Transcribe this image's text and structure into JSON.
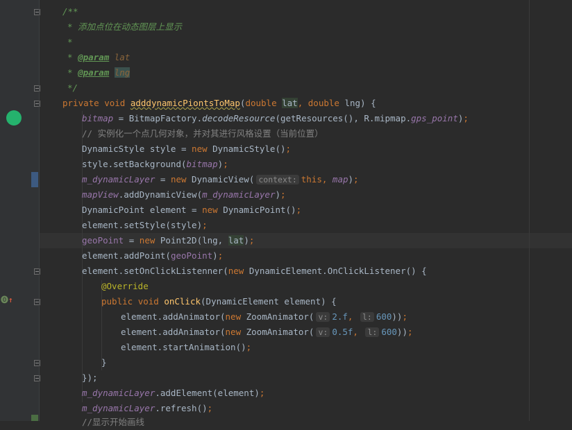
{
  "editor": {
    "doc_comment": {
      "open": "/**",
      "description": "* 添加点位在动态图层上显示",
      "blank": "*",
      "param_tag": "@param",
      "param1": "lat",
      "param2": "lng",
      "close": "*/"
    },
    "hints": {
      "context": "context:",
      "v": "v:",
      "l": "l:"
    },
    "strings": {
      "private": "private",
      "void": "void",
      "method_name": "adddynamicPiontsToMap",
      "double": "double",
      "lat": "lat",
      "lng": "lng",
      "bitmap": "bitmap",
      "bitmap_factory": " = BitmapFactory.",
      "decode": "decodeResource",
      "get_res": "(getResources(), R.mipmap.",
      "gps_point": "gps_point",
      "comment_line": "// 实例化一个点几何对象，并对其进行风格设置（当前位置）",
      "dynamic_style": "DynamicStyle style = ",
      "new": "new",
      "dynamic_style_ctor": " DynamicStyle()",
      "set_background": "style.setBackground(",
      "m_dynamic_layer": "m_dynamicLayer",
      "dynamic_view_ctor": " DynamicView(",
      "this": "this",
      "map": "map",
      "map_view": "mapView",
      "add_dynamic_view": ".addDynamicView(",
      "dynamic_point": "DynamicPoint element = ",
      "dynamic_point_ctor": " DynamicPoint()",
      "set_style": "element.setStyle(style)",
      "geo_point": "geoPoint",
      "point2d": " Point2D(lng, ",
      "add_point": "element.addPoint(",
      "set_on_click": "element.setOnClickListenner(",
      "click_listener": " DynamicElement.OnClickListener() {",
      "override": "@Override",
      "public": "public",
      "on_click": "onClick",
      "on_click_params": "(DynamicElement element) {",
      "add_animator": "element.addAnimator(",
      "zoom_animator": " ZoomAnimator(",
      "v1": "2.f",
      "v2": "0.5f",
      "l_val": "600",
      "start_animation": "element.startAnimation()",
      "close_brace": "}",
      "close_paren": "});",
      "add_element": ".addElement(element)",
      "refresh": ".refresh()",
      "partial_comment": "//显示开始画线"
    }
  }
}
